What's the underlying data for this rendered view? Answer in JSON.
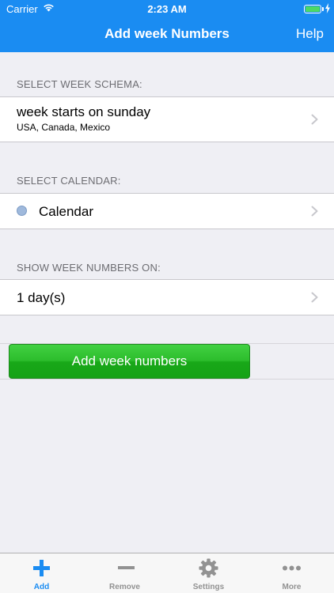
{
  "status_bar": {
    "carrier": "Carrier",
    "time": "2:23 AM",
    "battery_color": "#4cd964"
  },
  "nav": {
    "title": "Add week Numbers",
    "help_label": "Help",
    "color": "#1a8cf2"
  },
  "sections": {
    "week_schema": {
      "header": "SELECT WEEK SCHEMA:",
      "title": "week starts on sunday",
      "subtitle": "USA, Canada, Mexico"
    },
    "calendar": {
      "header": "SELECT CALENDAR:",
      "title": "Calendar",
      "dot_color": "#9fb9dc"
    },
    "show_on": {
      "header": "SHOW WEEK NUMBERS ON:",
      "title": "1 day(s)"
    }
  },
  "action": {
    "button_label": "Add week numbers",
    "button_color": "#2cbd2c"
  },
  "tabbar": {
    "tabs": [
      {
        "label": "Add",
        "icon": "plus-icon",
        "active": true
      },
      {
        "label": "Remove",
        "icon": "minus-icon",
        "active": false
      },
      {
        "label": "Settings",
        "icon": "gear-icon",
        "active": false
      },
      {
        "label": "More",
        "icon": "ellipsis-icon",
        "active": false
      }
    ],
    "active_color": "#1a8cf2",
    "inactive_color": "#929292"
  }
}
